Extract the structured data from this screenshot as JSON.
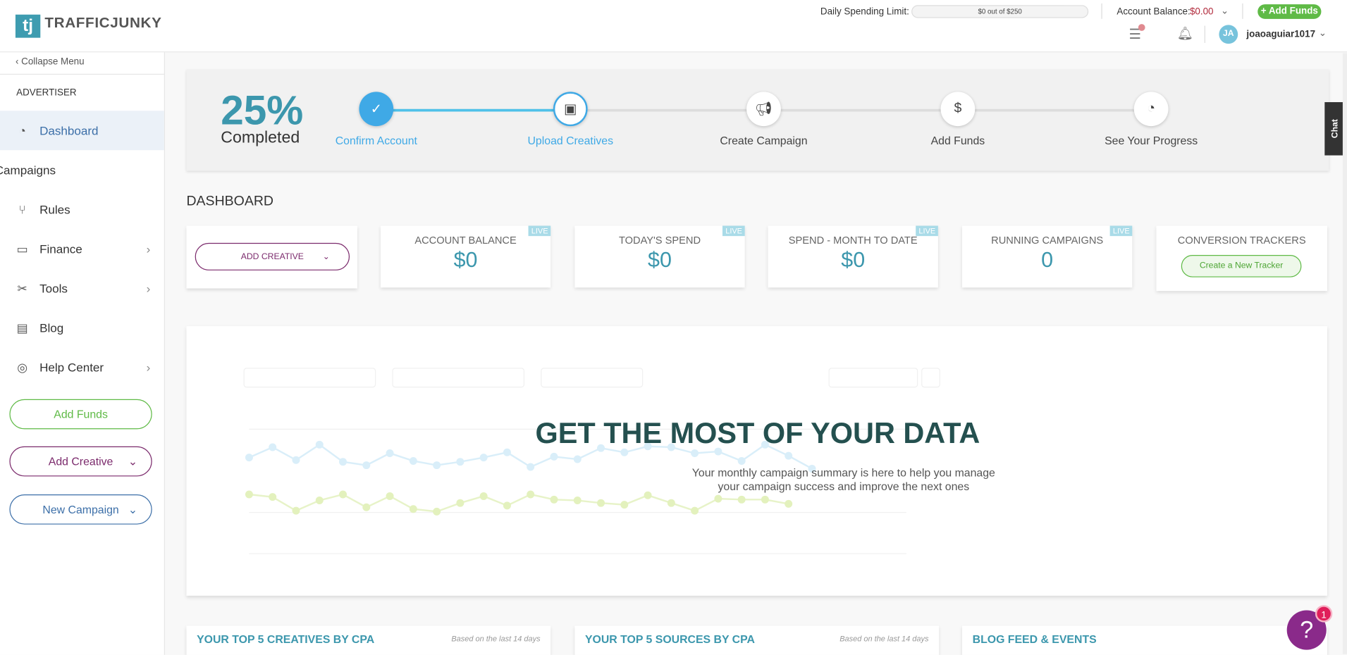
{
  "header": {
    "logo_mark": "tj",
    "logo_text": "TRAFFICJUNKY",
    "daily_limit_label": "Daily Spending Limit:",
    "daily_limit_value": "$0 out of $250",
    "daily_limit_progress": 0,
    "balance_label": "Account Balance:",
    "balance_value": "$0.00",
    "add_funds": "+ Add Funds",
    "avatar_initials": "JA",
    "username": "joaoaguiar1017"
  },
  "sidebar": {
    "collapse": "Collapse Menu",
    "section": "ADVERTISER",
    "items": [
      {
        "label": "Dashboard"
      },
      {
        "label": "Campaigns"
      },
      {
        "label": "Rules"
      },
      {
        "label": "Finance"
      },
      {
        "label": "Tools"
      },
      {
        "label": "Blog"
      },
      {
        "label": "Help Center"
      }
    ],
    "add_funds": "Add Funds",
    "add_creative": "Add Creative",
    "new_campaign": "New Campaign"
  },
  "progress": {
    "percent": "25%",
    "completed": "Completed",
    "steps": [
      {
        "label": "Confirm Account"
      },
      {
        "label": "Upload Creatives"
      },
      {
        "label": "Create Campaign"
      },
      {
        "label": "Add Funds"
      },
      {
        "label": "See Your Progress"
      }
    ]
  },
  "dashboard": {
    "title": "DASHBOARD",
    "add_creative": "ADD CREATIVE",
    "live": "LIVE",
    "stats": [
      {
        "title": "ACCOUNT BALANCE",
        "value": "$0"
      },
      {
        "title": "TODAY'S SPEND",
        "value": "$0"
      },
      {
        "title": "SPEND - MONTH TO DATE",
        "value": "$0"
      },
      {
        "title": "RUNNING CAMPAIGNS",
        "value": "0"
      }
    ],
    "conversion_title": "CONVERSION TRACKERS",
    "create_tracker": "Create a New Tracker"
  },
  "promo": {
    "title": "GET THE MOST OF YOUR DATA",
    "line1": "Your monthly campaign summary is here to help you manage",
    "line2": "your campaign success and improve the next ones"
  },
  "bottom": {
    "creatives": "YOUR TOP 5 CREATIVES BY CPA",
    "sources": "YOUR TOP 5 SOURCES BY CPA",
    "note": "Based on the last 14 days",
    "blog": "BLOG FEED & EVENTS"
  },
  "chat": "Chat",
  "help_badge": "1",
  "help": "?"
}
